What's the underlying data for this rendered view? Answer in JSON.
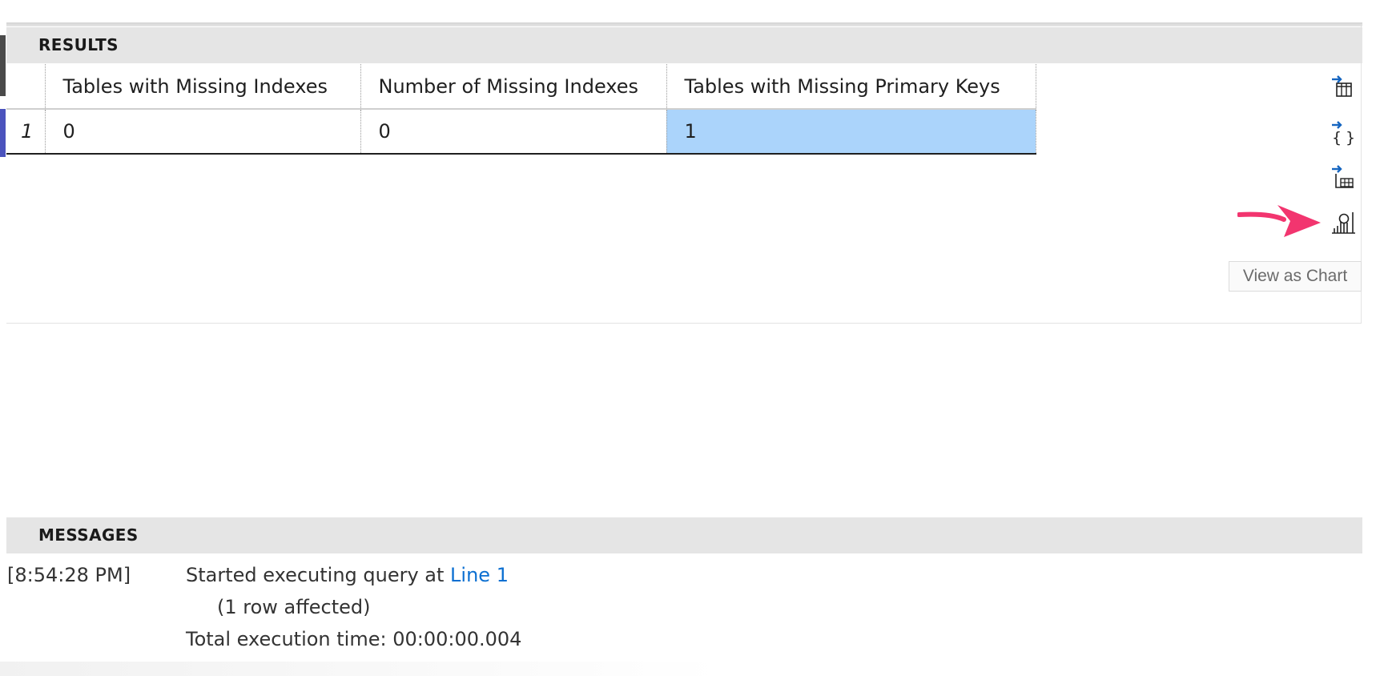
{
  "results": {
    "header": "RESULTS",
    "columns": [
      "Tables with Missing Indexes",
      "Number of Missing Indexes",
      "Tables with Missing Primary Keys"
    ],
    "rows": [
      {
        "num": "1",
        "cells": [
          "0",
          "0",
          "1"
        ]
      }
    ],
    "actions": [
      {
        "name": "save-as-csv",
        "icon": "export-table-icon"
      },
      {
        "name": "save-as-json",
        "icon": "export-json-icon"
      },
      {
        "name": "save-as-excel",
        "icon": "export-excel-icon"
      },
      {
        "name": "view-as-chart",
        "icon": "chart-icon"
      }
    ],
    "tooltip": "View as Chart"
  },
  "messages": {
    "header": "MESSAGES",
    "time": "[8:54:28 PM]",
    "line1_prefix": "Started executing query at ",
    "line1_link": "Line 1",
    "line2": "(1 row affected)",
    "line3": "Total execution time: 00:00:00.004"
  },
  "colors": {
    "header_bg": "#e5e5e5",
    "selected_cell": "#abd4fb",
    "link": "#0b6fd1",
    "arrow": "#f2356f",
    "icon_accent": "#1565c0"
  }
}
